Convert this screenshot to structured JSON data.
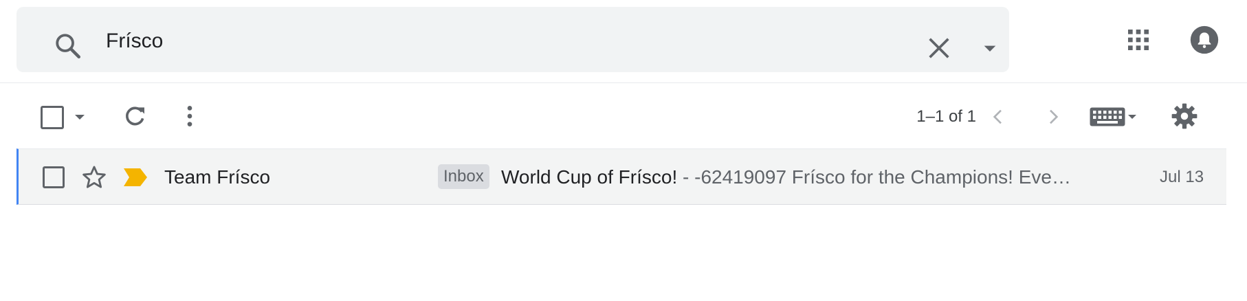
{
  "search": {
    "value": "Frísco",
    "placeholder": "Search mail",
    "icons": {
      "search": "search-icon",
      "clear": "close-icon",
      "options": "arrow-drop-down-icon"
    }
  },
  "header": {
    "apps_icon": "apps-grid-icon",
    "notifications_icon": "notifications-bell-icon"
  },
  "toolbar": {
    "pagination": "1–1 of 1",
    "icons": [
      "checkbox",
      "arrow-drop-down-icon",
      "refresh-icon",
      "more-vert-icon",
      "chevron-left-icon",
      "chevron-right-icon",
      "keyboard-icon",
      "settings-icon"
    ]
  },
  "emails": [
    {
      "sender": "Team Frísco",
      "label": "Inbox",
      "subject": "World Cup of Frísco!",
      "snippet": " - -62419097 Frísco for the Champions! Eve…",
      "date": "Jul 13",
      "starred": false,
      "important": true
    }
  ],
  "colors": {
    "selected_row_bg": "#f3f4f4",
    "selected_row_border": "#4285f4",
    "importance_marker": "#f4b400",
    "icon_gray": "#5f6368",
    "search_bg": "#f1f3f4"
  }
}
